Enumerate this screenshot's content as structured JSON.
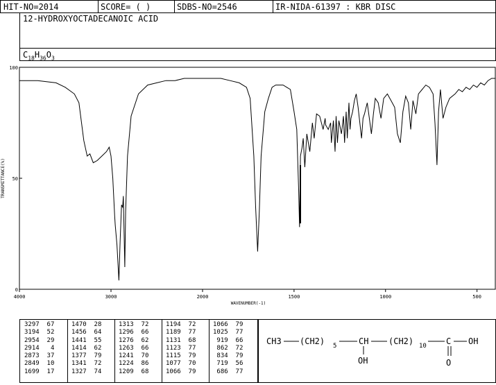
{
  "header": {
    "hit_no": "HIT-NO=2014",
    "score": "SCORE=  (   )",
    "sdbs_no": "SDBS-NO=2546",
    "ir_nida": "IR-NIDA-61397 : KBR DISC"
  },
  "compound_name": "12-HYDROXYOCTADECANOIC ACID",
  "formula": {
    "c": "C",
    "c_n": "18",
    "h": "H",
    "h_n": "36",
    "o": "O",
    "o_n": "3"
  },
  "chart_data": {
    "type": "line",
    "xlabel": "WAVENUMBER(-1)",
    "ylabel": "TRANSMITTANCE(%)",
    "xlim": [
      4000,
      400
    ],
    "ylim": [
      0,
      100
    ],
    "x_ticks": [
      4000,
      3000,
      2000,
      1500,
      1000,
      500
    ],
    "x_tick_labels": [
      "4000",
      "3000",
      "2000",
      "1500",
      "1000",
      "500"
    ],
    "y_ticks": [
      0,
      50,
      100
    ],
    "y_tick_labels": [
      "0",
      "50",
      "100"
    ],
    "series": [
      {
        "x": [
          4000,
          3800,
          3600,
          3500,
          3400,
          3350,
          3297,
          3260,
          3230,
          3194,
          3150,
          3100,
          3050,
          3020,
          3000,
          2980,
          2960,
          2954,
          2935,
          2914,
          2900,
          2885,
          2873,
          2865,
          2858,
          2849,
          2840,
          2820,
          2780,
          2700,
          2600,
          2500,
          2400,
          2300,
          2200,
          2100,
          2000,
          1900,
          1850,
          1800,
          1760,
          1740,
          1720,
          1710,
          1699,
          1690,
          1680,
          1660,
          1640,
          1620,
          1600,
          1580,
          1560,
          1540,
          1520,
          1500,
          1485,
          1475,
          1470,
          1465,
          1456,
          1450,
          1441,
          1430,
          1414,
          1400,
          1390,
          1377,
          1360,
          1341,
          1330,
          1327,
          1313,
          1300,
          1296,
          1285,
          1276,
          1270,
          1263,
          1255,
          1241,
          1230,
          1224,
          1215,
          1209,
          1200,
          1194,
          1189,
          1180,
          1170,
          1160,
          1150,
          1131,
          1123,
          1115,
          1100,
          1090,
          1077,
          1066,
          1056,
          1040,
          1025,
          1010,
          990,
          970,
          950,
          935,
          919,
          905,
          890,
          875,
          862,
          850,
          834,
          820,
          800,
          780,
          760,
          740,
          730,
          719,
          710,
          700,
          686,
          670,
          650,
          620,
          600,
          580,
          560,
          540,
          520,
          500,
          480,
          460,
          440,
          420,
          400
        ],
        "y": [
          94,
          94,
          93,
          91,
          88,
          84,
          67,
          60,
          61,
          57,
          58,
          60,
          62,
          64,
          60,
          50,
          33,
          29,
          20,
          4,
          22,
          38,
          37,
          42,
          28,
          10,
          35,
          60,
          78,
          88,
          92,
          93,
          94,
          94,
          95,
          95,
          95,
          95,
          94,
          93,
          91,
          86,
          60,
          37,
          17,
          35,
          60,
          80,
          86,
          91,
          92,
          92,
          92,
          91,
          90,
          80,
          72,
          45,
          28,
          60,
          64,
          68,
          55,
          70,
          62,
          75,
          68,
          79,
          78,
          72,
          77,
          74,
          72,
          75,
          66,
          76,
          62,
          78,
          66,
          76,
          70,
          78,
          66,
          80,
          68,
          84,
          72,
          77,
          80,
          85,
          88,
          82,
          68,
          77,
          79,
          84,
          78,
          70,
          79,
          86,
          84,
          77,
          86,
          88,
          85,
          82,
          70,
          66,
          80,
          87,
          84,
          72,
          85,
          79,
          88,
          90,
          92,
          91,
          88,
          75,
          56,
          80,
          90,
          77,
          82,
          86,
          88,
          90,
          89,
          91,
          90,
          92,
          91,
          93,
          92,
          94,
          95,
          95
        ]
      }
    ],
    "peak_table": [
      [
        [
          "3297",
          "67"
        ],
        [
          "3194",
          "52"
        ],
        [
          "2954",
          "29"
        ],
        [
          "2914",
          "4"
        ],
        [
          "2873",
          "37"
        ],
        [
          "2849",
          "10"
        ],
        [
          "1699",
          "17"
        ]
      ],
      [
        [
          "1470",
          "28"
        ],
        [
          "1456",
          "64"
        ],
        [
          "1441",
          "55"
        ],
        [
          "1414",
          "62"
        ],
        [
          "1377",
          "79"
        ],
        [
          "1341",
          "72"
        ],
        [
          "1327",
          "74"
        ]
      ],
      [
        [
          "1313",
          "72"
        ],
        [
          "1296",
          "66"
        ],
        [
          "1276",
          "62"
        ],
        [
          "1263",
          "66"
        ],
        [
          "1241",
          "70"
        ],
        [
          "1224",
          "86"
        ],
        [
          "1209",
          "68"
        ]
      ],
      [
        [
          "1194",
          "72"
        ],
        [
          "1189",
          "77"
        ],
        [
          "1131",
          "68"
        ],
        [
          "1123",
          "77"
        ],
        [
          "1115",
          "79"
        ],
        [
          "1077",
          "70"
        ],
        [
          "1066",
          "79"
        ]
      ],
      [
        [
          "1066",
          "79"
        ],
        [
          "1025",
          "77"
        ],
        [
          "919",
          "66"
        ],
        [
          "862",
          "72"
        ],
        [
          "834",
          "79"
        ],
        [
          "719",
          "56"
        ],
        [
          "686",
          "77"
        ]
      ]
    ]
  },
  "structure": {
    "ch3": "CH3",
    "ch2_a": "(CH2)",
    "sub5": "5",
    "ch": "CH",
    "ch2_b": "(CH2)",
    "sub10": "10",
    "c": "C",
    "oh": "OH",
    "oh_sub": "OH",
    "o": "O"
  }
}
